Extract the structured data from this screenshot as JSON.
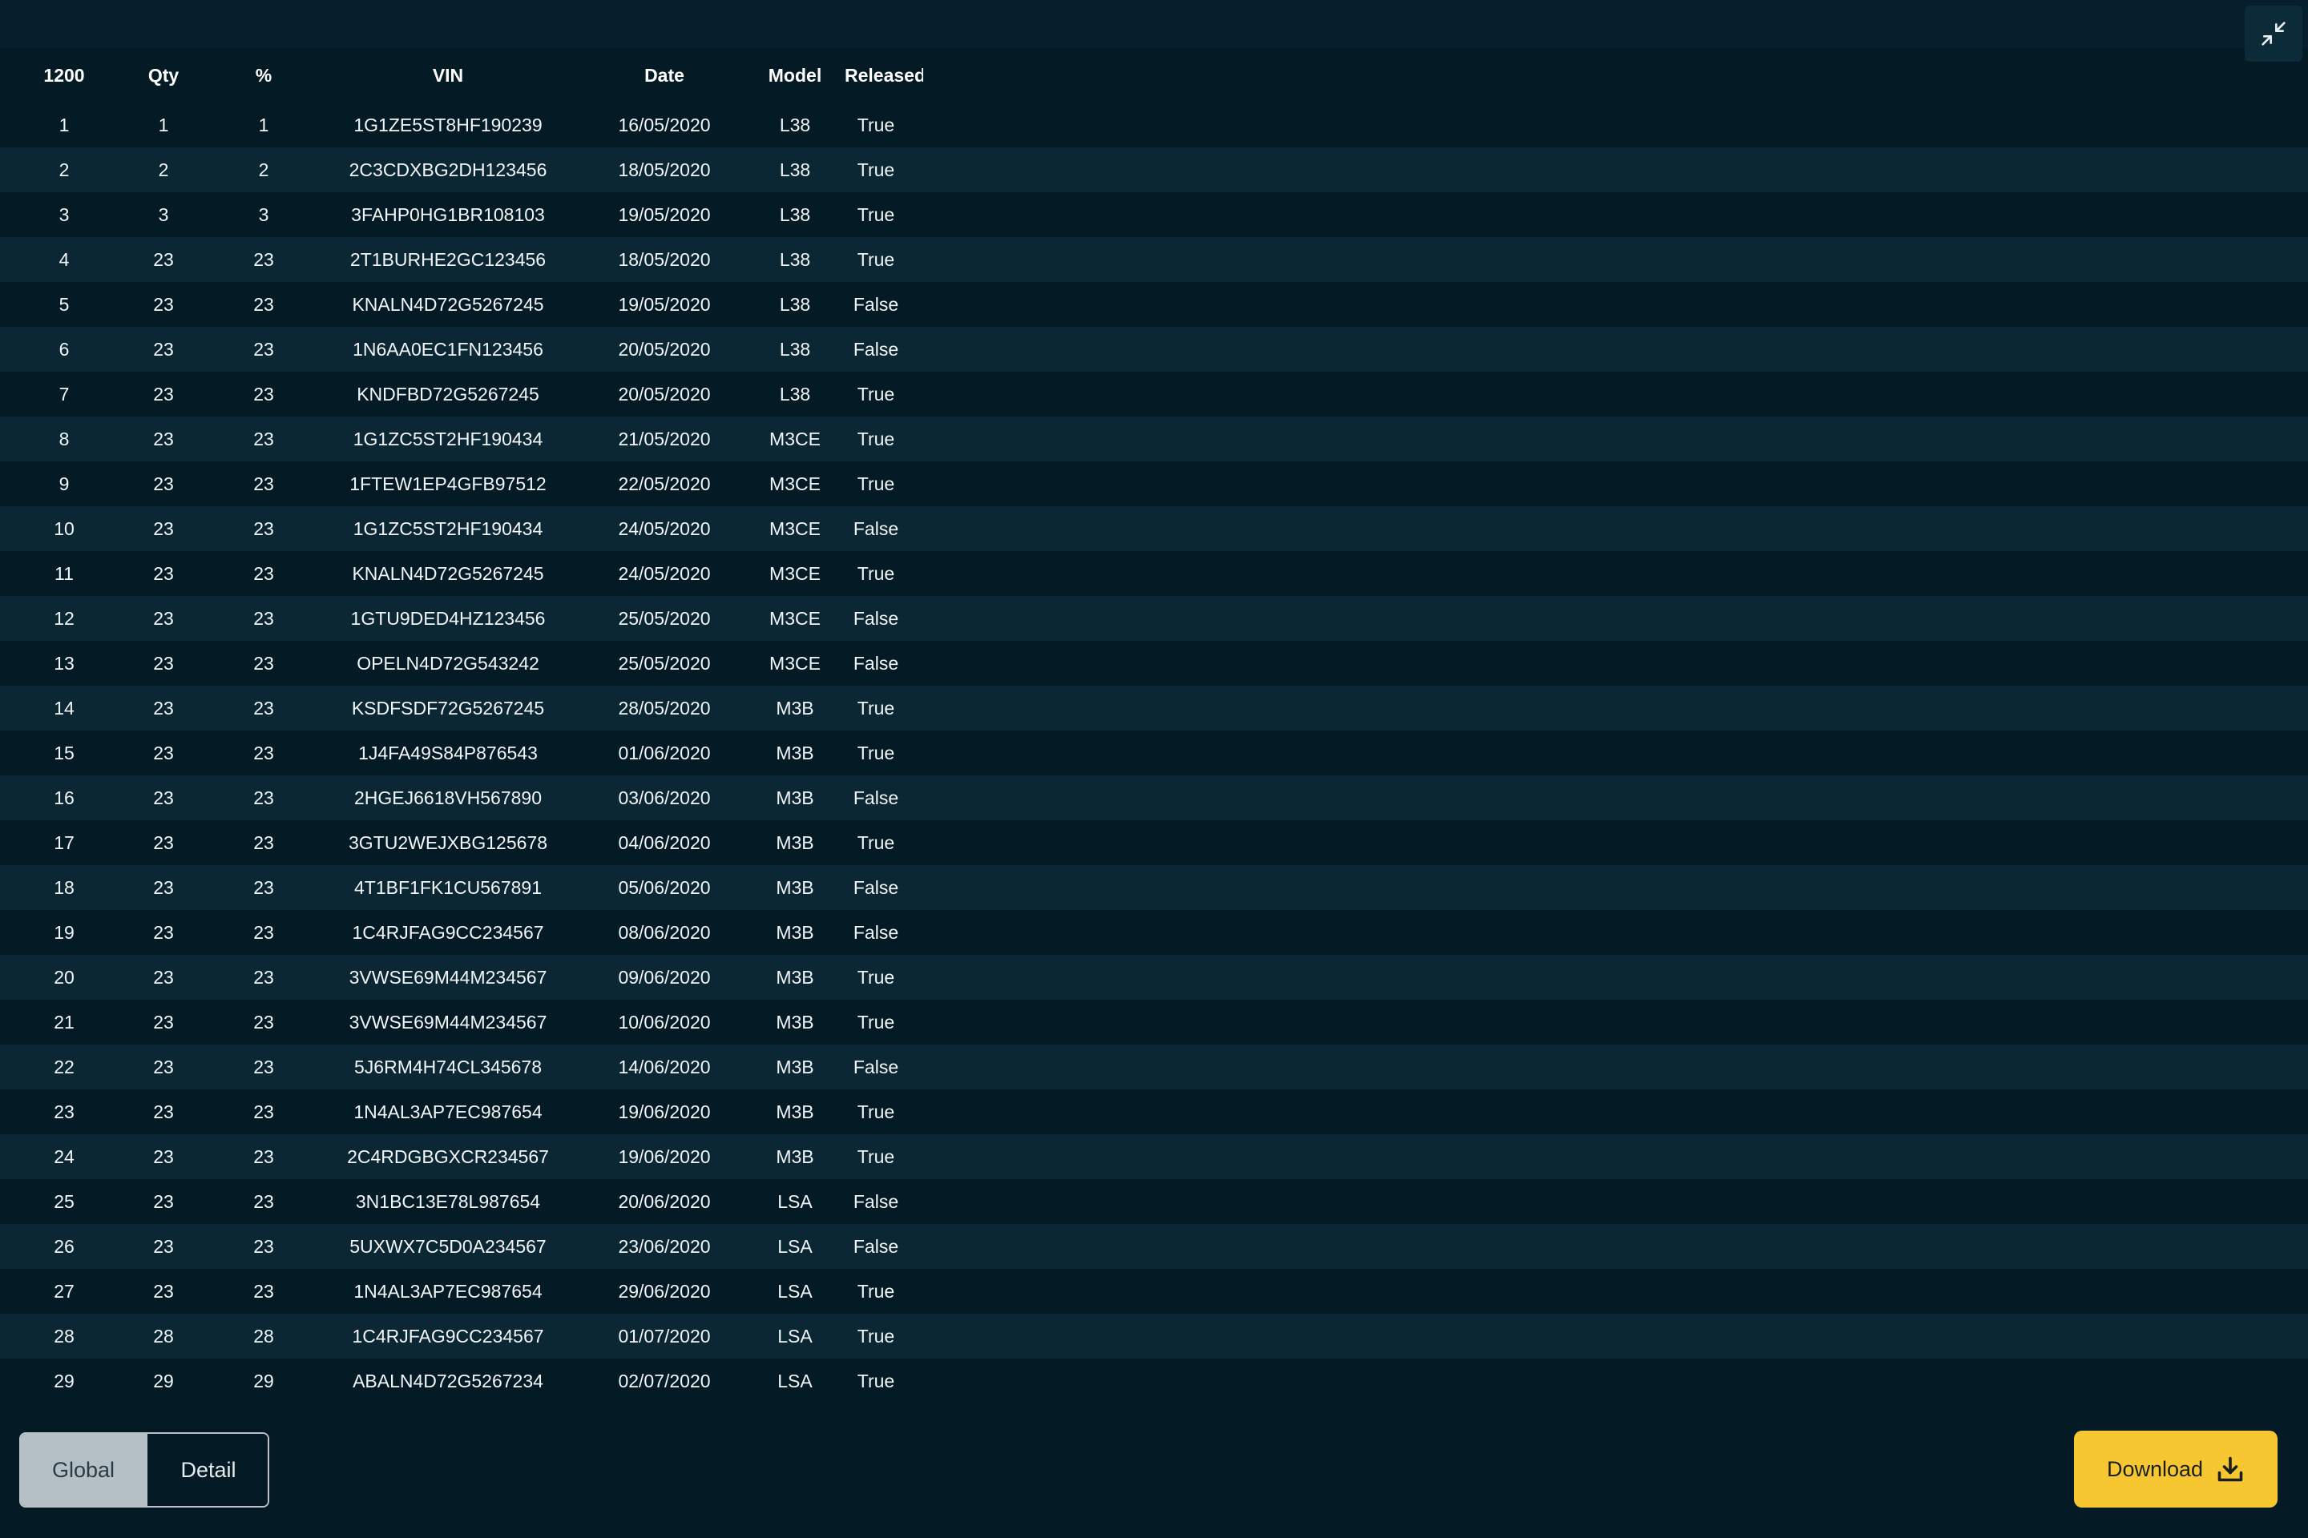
{
  "table": {
    "headers": [
      "1200",
      "Qty",
      "%",
      "VIN",
      "Date",
      "Model",
      "Released"
    ],
    "rows": [
      [
        "1",
        "1",
        "1",
        "1G1ZE5ST8HF190239",
        "16/05/2020",
        "L38",
        "True"
      ],
      [
        "2",
        "2",
        "2",
        "2C3CDXBG2DH123456",
        "18/05/2020",
        "L38",
        "True"
      ],
      [
        "3",
        "3",
        "3",
        "3FAHP0HG1BR108103",
        "19/05/2020",
        "L38",
        "True"
      ],
      [
        "4",
        "23",
        "23",
        "2T1BURHE2GC123456",
        "18/05/2020",
        "L38",
        "True"
      ],
      [
        "5",
        "23",
        "23",
        "KNALN4D72G5267245",
        "19/05/2020",
        "L38",
        "False"
      ],
      [
        "6",
        "23",
        "23",
        "1N6AA0EC1FN123456",
        "20/05/2020",
        "L38",
        "False"
      ],
      [
        "7",
        "23",
        "23",
        "KNDFBD72G5267245",
        "20/05/2020",
        "L38",
        "True"
      ],
      [
        "8",
        "23",
        "23",
        "1G1ZC5ST2HF190434",
        "21/05/2020",
        "M3CE",
        "True"
      ],
      [
        "9",
        "23",
        "23",
        "1FTEW1EP4GFB97512",
        "22/05/2020",
        "M3CE",
        "True"
      ],
      [
        "10",
        "23",
        "23",
        "1G1ZC5ST2HF190434",
        "24/05/2020",
        "M3CE",
        "False"
      ],
      [
        "11",
        "23",
        "23",
        "KNALN4D72G5267245",
        "24/05/2020",
        "M3CE",
        "True"
      ],
      [
        "12",
        "23",
        "23",
        "1GTU9DED4HZ123456",
        "25/05/2020",
        "M3CE",
        "False"
      ],
      [
        "13",
        "23",
        "23",
        "OPELN4D72G543242",
        "25/05/2020",
        "M3CE",
        "False"
      ],
      [
        "14",
        "23",
        "23",
        "KSDFSDF72G5267245",
        "28/05/2020",
        "M3B",
        "True"
      ],
      [
        "15",
        "23",
        "23",
        "1J4FA49S84P876543",
        "01/06/2020",
        "M3B",
        "True"
      ],
      [
        "16",
        "23",
        "23",
        "2HGEJ6618VH567890",
        "03/06/2020",
        "M3B",
        "False"
      ],
      [
        "17",
        "23",
        "23",
        "3GTU2WEJXBG125678",
        "04/06/2020",
        "M3B",
        "True"
      ],
      [
        "18",
        "23",
        "23",
        "4T1BF1FK1CU567891",
        "05/06/2020",
        "M3B",
        "False"
      ],
      [
        "19",
        "23",
        "23",
        "1C4RJFAG9CC234567",
        "08/06/2020",
        "M3B",
        "False"
      ],
      [
        "20",
        "23",
        "23",
        "3VWSE69M44M234567",
        "09/06/2020",
        "M3B",
        "True"
      ],
      [
        "21",
        "23",
        "23",
        "3VWSE69M44M234567",
        "10/06/2020",
        "M3B",
        "True"
      ],
      [
        "22",
        "23",
        "23",
        "5J6RM4H74CL345678",
        "14/06/2020",
        "M3B",
        "False"
      ],
      [
        "23",
        "23",
        "23",
        "1N4AL3AP7EC987654",
        "19/06/2020",
        "M3B",
        "True"
      ],
      [
        "24",
        "23",
        "23",
        "2C4RDGBGXCR234567",
        "19/06/2020",
        "M3B",
        "True"
      ],
      [
        "25",
        "23",
        "23",
        "3N1BC13E78L987654",
        "20/06/2020",
        "LSA",
        "False"
      ],
      [
        "26",
        "23",
        "23",
        "5UXWX7C5D0A234567",
        "23/06/2020",
        "LSA",
        "False"
      ],
      [
        "27",
        "23",
        "23",
        "1N4AL3AP7EC987654",
        "29/06/2020",
        "LSA",
        "True"
      ],
      [
        "28",
        "28",
        "28",
        "1C4RJFAG9CC234567",
        "01/07/2020",
        "LSA",
        "True"
      ],
      [
        "29",
        "29",
        "29",
        "ABALN4D72G5267234",
        "02/07/2020",
        "LSA",
        "True"
      ]
    ]
  },
  "view_toggle": {
    "global_label": "Global",
    "detail_label": "Detail",
    "selected": "Global"
  },
  "download": {
    "label": "Download"
  },
  "icons": {
    "collapse": "collapse-arrows-icon",
    "download": "download-icon"
  },
  "colors": {
    "background": "#041b25",
    "row_alt": "#0a2733",
    "accent": "#f6c731",
    "toggle_selected": "#b4c0c5"
  }
}
